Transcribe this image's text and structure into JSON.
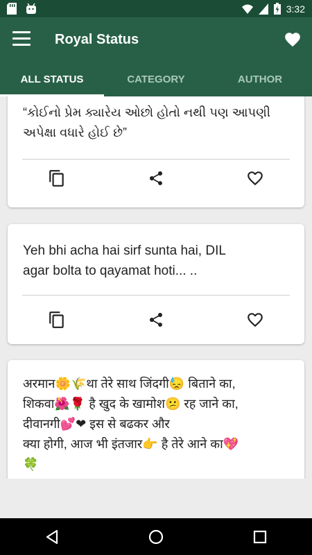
{
  "status_bar": {
    "time": "3:32",
    "battery_percent": 65,
    "icons": [
      "sd-card-icon",
      "android-icon",
      "wifi-icon",
      "signal-icon",
      "battery-icon"
    ]
  },
  "app_bar": {
    "title": "Royal Status",
    "menu_icon": "hamburger-menu-icon",
    "favorites_icon": "heart-icon"
  },
  "tabs": [
    {
      "label": "ALL STATUS",
      "active": true
    },
    {
      "label": "CATEGORY",
      "active": false
    },
    {
      "label": "AUTHOR",
      "active": false
    }
  ],
  "cards": [
    {
      "text": "“કોઈનો પ્રેમ ક્યારેય ઓછો હોતો નથી પણ આપણી\nઅપેક્ષા વધારે હોઈ છે”"
    },
    {
      "text": "Yeh bhi acha hai sirf sunta hai,       DIL\nagar bolta to qayamat hoti... .."
    },
    {
      "text": "अरमान🌼🌾था तेरे साथ जिंदगी😓 बिताने का,\n शिकवा🌺🌹 है खुद के खामोश😕 रह जाने का,\n दीवानगी💕❤ इस से बढकर और\nक्या होगी, आज भी इंतजार👉 है तेरे आने का💖\n🍀"
    }
  ],
  "card_actions": {
    "copy_icon": "copy-icon",
    "share_icon": "share-icon",
    "favorite_icon": "heart-outline-icon"
  },
  "colors": {
    "primary": "#286047",
    "primary_dark": "#1b4d36",
    "tab_inactive": "#a9c9b9",
    "background": "#ececec"
  },
  "nav_bar": {
    "icons": [
      "back-icon",
      "home-icon",
      "recents-icon"
    ]
  }
}
